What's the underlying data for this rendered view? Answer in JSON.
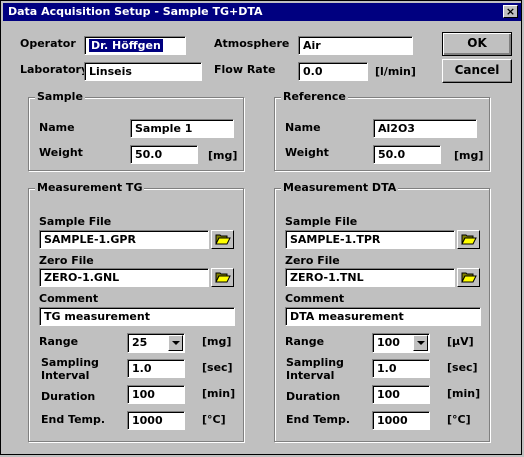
{
  "window": {
    "title": "Data Acquisition Setup - Sample TG+DTA",
    "close_glyph": "×"
  },
  "header": {
    "operator_label": "Operator",
    "operator_value": "Dr. Höffgen",
    "laboratory_label": "Laboratory",
    "laboratory_value": "Linseis",
    "atmosphere_label": "Atmosphere",
    "atmosphere_value": "Air",
    "flow_rate_label": "Flow Rate",
    "flow_rate_value": "0.0",
    "flow_rate_unit": "[l/min]"
  },
  "buttons": {
    "ok_label": "OK",
    "cancel_label": "Cancel"
  },
  "sample": {
    "title": "Sample",
    "name_label": "Name",
    "name_value": "Sample 1",
    "weight_label": "Weight",
    "weight_value": "50.0",
    "weight_unit": "[mg]"
  },
  "reference": {
    "title": "Reference",
    "name_label": "Name",
    "name_value": "Al2O3",
    "weight_label": "Weight",
    "weight_value": "50.0",
    "weight_unit": "[mg]"
  },
  "tg": {
    "title": "Measurement TG",
    "sample_file_label": "Sample File",
    "sample_file_value": "SAMPLE-1.GPR",
    "zero_file_label": "Zero File",
    "zero_file_value": "ZERO-1.GNL",
    "comment_label": "Comment",
    "comment_value": "TG measurement",
    "range_label": "Range",
    "range_value": "25",
    "range_unit": "[mg]",
    "sampling_label_1": "Sampling",
    "sampling_label_2": "Interval",
    "sampling_value": "1.0",
    "sampling_unit": "[sec]",
    "duration_label": "Duration",
    "duration_value": "100",
    "duration_unit": "[min]",
    "end_temp_label": "End Temp.",
    "end_temp_value": "1000",
    "end_temp_unit": "[°C]"
  },
  "dta": {
    "title": "Measurement DTA",
    "sample_file_label": "Sample File",
    "sample_file_value": "SAMPLE-1.TPR",
    "zero_file_label": "Zero File",
    "zero_file_value": "ZERO-1.TNL",
    "comment_label": "Comment",
    "comment_value": "DTA measurement",
    "range_label": "Range",
    "range_value": "100",
    "range_unit": "[µV]",
    "sampling_label_1": "Sampling",
    "sampling_label_2": "Interval",
    "sampling_value": "1.0",
    "sampling_unit": "[sec]",
    "duration_label": "Duration",
    "duration_value": "100",
    "duration_unit": "[min]",
    "end_temp_label": "End Temp.",
    "end_temp_value": "1000",
    "end_temp_unit": "[°C]"
  },
  "icons": {
    "browse": "folder-open-icon",
    "dropdown": "chevron-down-icon",
    "close": "close-icon"
  }
}
